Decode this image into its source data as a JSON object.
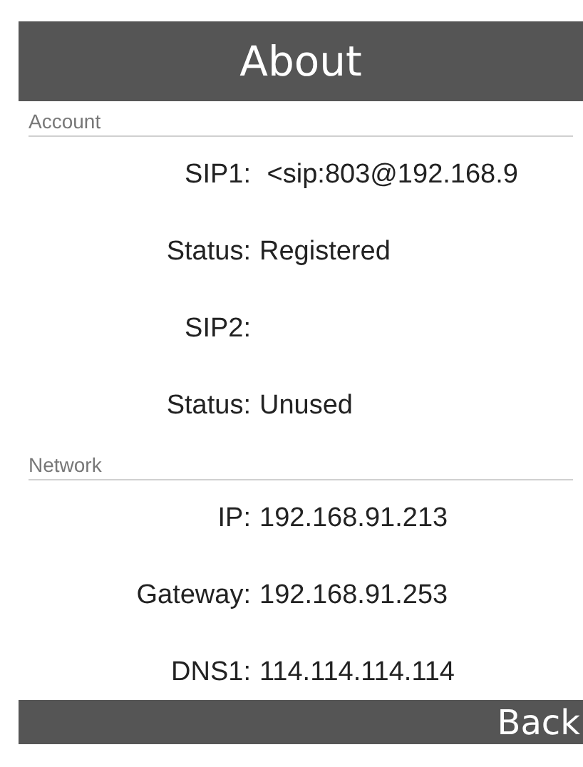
{
  "title": "About",
  "sections": [
    {
      "heading": "Account",
      "rows": [
        {
          "label": "SIP1:",
          "value": " <sip:803@192.168.9"
        },
        {
          "label": "Status:",
          "value": "Registered"
        },
        {
          "label": "SIP2:",
          "value": ""
        },
        {
          "label": "Status:",
          "value": "Unused"
        }
      ]
    },
    {
      "heading": "Network",
      "rows": [
        {
          "label": "IP:",
          "value": "192.168.91.213"
        },
        {
          "label": "Gateway:",
          "value": "192.168.91.253"
        },
        {
          "label": "DNS1:",
          "value": "114.114.114.114"
        }
      ]
    }
  ],
  "footer_button": "Back"
}
